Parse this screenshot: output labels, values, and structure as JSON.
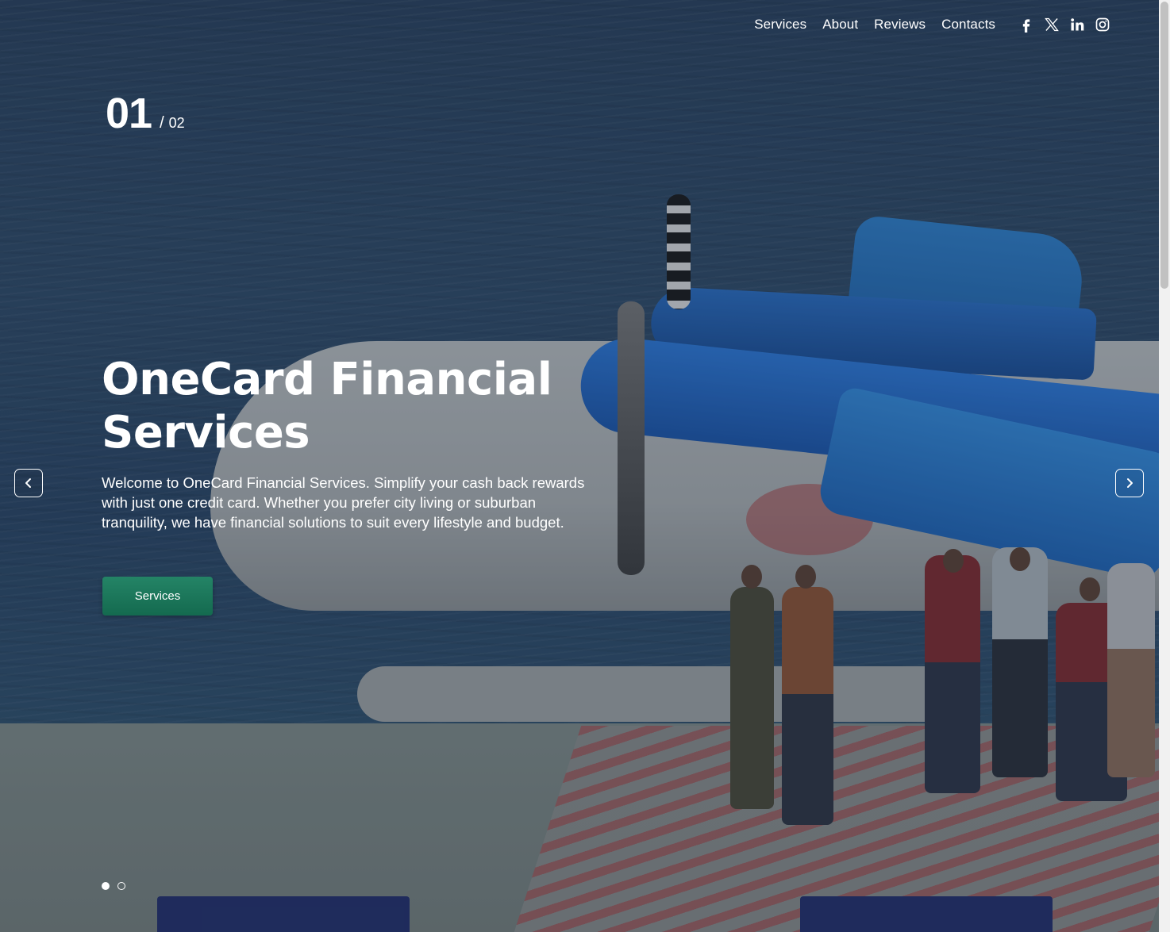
{
  "nav": {
    "links": [
      "Services",
      "About",
      "Reviews",
      "Contacts"
    ],
    "social": [
      "facebook-icon",
      "x-twitter-icon",
      "linkedin-icon",
      "instagram-icon"
    ]
  },
  "slider": {
    "current": "01",
    "separator": "/",
    "total": "02",
    "active_dot": 1,
    "dot_count": 2
  },
  "hero": {
    "title": "OneCard Financial Services",
    "text": "Welcome to OneCard Financial Services. Simplify your cash back rewards with just one credit card. Whether you prefer city living or suburban tranquility, we have financial solutions to suit every lifestyle and budget.",
    "button_label": "Services"
  },
  "colors": {
    "button": "#1b7a5c",
    "text": "#ffffff"
  }
}
